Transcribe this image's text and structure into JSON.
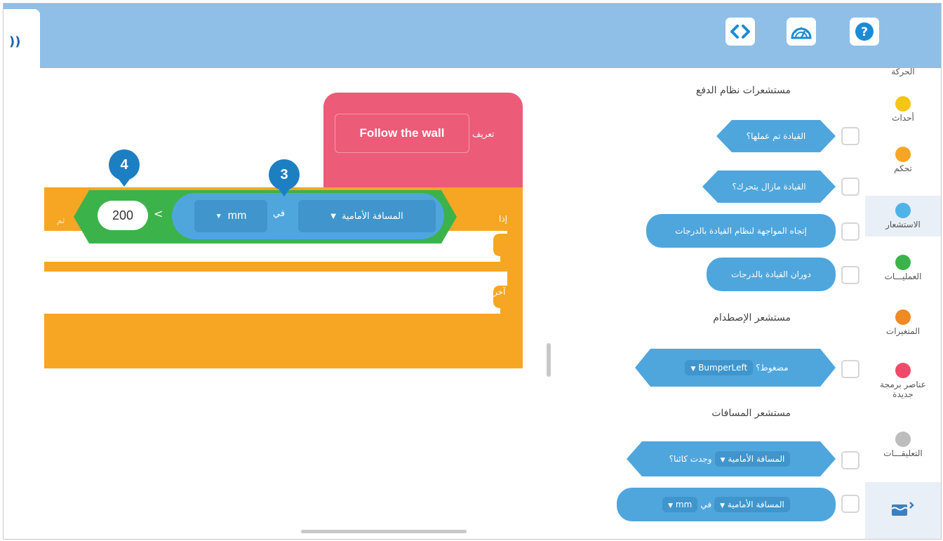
{
  "toolbar": {
    "left_tab_icon": "sound-icon",
    "left_tab_glyph": "))",
    "code_icon": "code-icon",
    "dashboard_icon": "dashboard-icon",
    "help_icon": "help-icon",
    "code_glyph": "<>",
    "help_glyph": "?"
  },
  "categories": [
    {
      "label": "الحركة",
      "color": ""
    },
    {
      "label": "أحداث",
      "color": "#f5c518"
    },
    {
      "label": "تحكم",
      "color": "#f6a623"
    },
    {
      "label": "الاستشعار",
      "color": "#4fb3e8"
    },
    {
      "label": "العمليـــات",
      "color": "#3cb34a"
    },
    {
      "label": "المتغيرات",
      "color": "#f08a24"
    },
    {
      "label": "عناصر برمجة جديدة",
      "color": "#ef4a6a"
    },
    {
      "label": "التعليقـــات",
      "color": "#bdbdbd"
    }
  ],
  "palette": {
    "sections": [
      {
        "title": "مستشعرات نظام الدفع"
      },
      {
        "title": "مستشعر الإصطدام"
      },
      {
        "title": "مستشعر المسافات"
      }
    ],
    "blocks": {
      "drive_done": "القيادة تم عملها؟",
      "drive_moving": "القيادة مازال يتحرك؟",
      "drive_heading": "إتجاه المواجهة لنظام القيادة بالدرجات",
      "drive_rotation": "دوران القيادة بالدرجات",
      "bumper_dropdown": "BumperLeft",
      "bumper_pressed": "مضغوط؟",
      "dist_sensor_1": "المسافة الأمامية",
      "dist_found": "وجدت كائنا؟",
      "dist_sensor_2": "المسافة الأمامية",
      "dist_in": "في",
      "dist_unit": "mm"
    }
  },
  "canvas": {
    "define_label": "تعريف",
    "define_name": "Follow the wall",
    "if_label": "إذا",
    "then_label": "ثم",
    "else_label": "آخر",
    "compare_value": "200",
    "compare_op": "<",
    "distance_sensor": "المسافة الأمامية",
    "distance_in": "في",
    "distance_unit": "mm",
    "badge_left": "4",
    "badge_right": "3"
  }
}
